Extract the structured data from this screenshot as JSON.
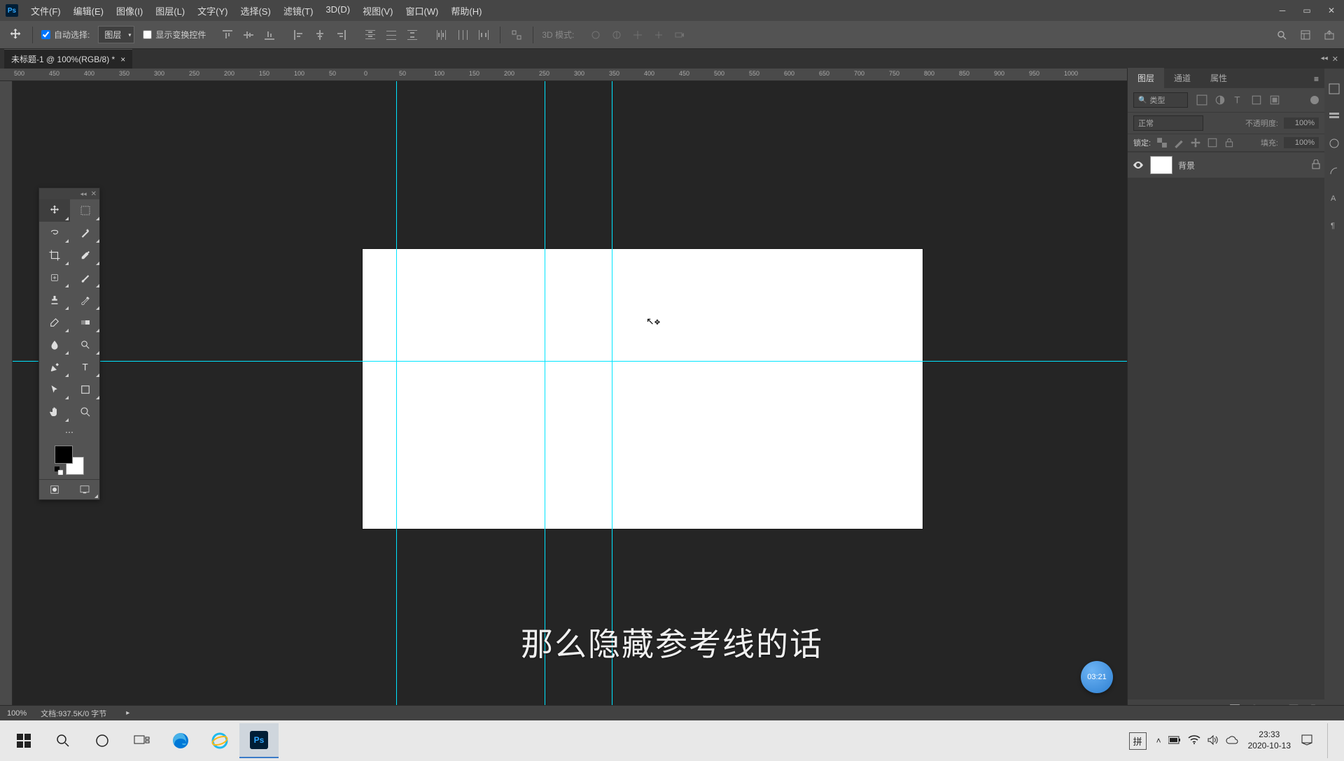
{
  "menu": [
    "文件(F)",
    "编辑(E)",
    "图像(I)",
    "图层(L)",
    "文字(Y)",
    "选择(S)",
    "滤镜(T)",
    "3D(D)",
    "视图(V)",
    "窗口(W)",
    "帮助(H)"
  ],
  "options": {
    "auto_select_checked": true,
    "auto_select_label": "自动选择:",
    "target_dropdown": "图层",
    "show_transform_label": "显示变换控件",
    "threeD_label": "3D 模式:"
  },
  "doc_tab": {
    "title": "未标题-1 @ 100%(RGB/8) *"
  },
  "ruler_ticks": [
    "500",
    "450",
    "400",
    "350",
    "300",
    "250",
    "200",
    "150",
    "100",
    "50",
    "0",
    "50",
    "100",
    "150",
    "200",
    "250",
    "300",
    "350",
    "400",
    "450",
    "500",
    "550",
    "600",
    "650",
    "700",
    "750",
    "800",
    "850",
    "900",
    "950",
    "1000"
  ],
  "panels": {
    "tabs": [
      "图层",
      "通道",
      "属性"
    ],
    "filter_label": "类型",
    "blend_mode": "正常",
    "opacity_label": "不透明度:",
    "opacity_value": "100%",
    "lock_label": "锁定:",
    "fill_label": "填充:",
    "fill_value": "100%",
    "layer_name": "背景"
  },
  "status": {
    "zoom": "100%",
    "doc_info": "文档:937.5K/0 字节"
  },
  "subtitle": "那么隐藏参考线的话",
  "badge_time": "03:21",
  "taskbar": {
    "ime": "拼",
    "time": "23:33",
    "date": "2020-10-13"
  }
}
